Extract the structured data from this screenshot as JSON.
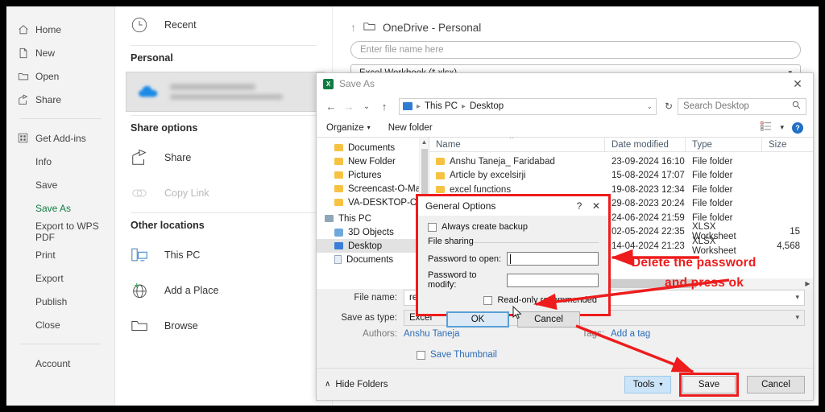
{
  "backstage": {
    "sidebar": [
      {
        "label": "Home",
        "icon": "home-icon",
        "type": "icon"
      },
      {
        "label": "New",
        "icon": "new-document-icon",
        "type": "icon"
      },
      {
        "label": "Open",
        "icon": "open-folder-icon",
        "type": "icon"
      },
      {
        "label": "Share",
        "icon": "share-icon",
        "type": "icon"
      },
      {
        "label": "Get Add-ins",
        "icon": "addins-grid-icon",
        "type": "icon"
      },
      {
        "label": "Info",
        "type": "plain"
      },
      {
        "label": "Save",
        "type": "plain"
      },
      {
        "label": "Save As",
        "type": "plain",
        "active": true
      },
      {
        "label": "Export to WPS PDF",
        "type": "plain"
      },
      {
        "label": "Print",
        "type": "plain"
      },
      {
        "label": "Export",
        "type": "plain"
      },
      {
        "label": "Publish",
        "type": "plain"
      },
      {
        "label": "Close",
        "type": "plain"
      },
      {
        "label": "Account",
        "type": "plain"
      }
    ],
    "middle": {
      "recent": "Recent",
      "personal_heading": "Personal",
      "onedrive_blurred": true,
      "share_options_heading": "Share options",
      "share": "Share",
      "copy_link": "Copy Link",
      "other_locations_heading": "Other locations",
      "this_pc": "This PC",
      "add_a_place": "Add a Place",
      "browse": "Browse"
    },
    "right": {
      "location": "OneDrive - Personal",
      "filename_placeholder": "Enter file name here",
      "filetype": "Excel Workbook (*.xlsx)"
    }
  },
  "saveas": {
    "title": "Save As",
    "close_label": "✕",
    "nav": {
      "back": "←",
      "forward": "→",
      "recent_caret": "⌄",
      "up": "↑",
      "breadcrumb": [
        "This PC",
        "Desktop"
      ],
      "address_caret": "⌄",
      "refresh": "↻",
      "search_placeholder": "Search Desktop"
    },
    "toolbar": {
      "organize": "Organize",
      "organize_caret": "▾",
      "new_folder": "New folder",
      "view_caret": "▾",
      "help": "?"
    },
    "tree": [
      {
        "label": "Documents",
        "icon": "folder-icon",
        "kind": "fold"
      },
      {
        "label": "New Folder",
        "icon": "folder-icon",
        "kind": "fold"
      },
      {
        "label": "Pictures",
        "icon": "folder-icon",
        "kind": "fold"
      },
      {
        "label": "Screencast-O-Ma",
        "icon": "folder-icon",
        "kind": "fold"
      },
      {
        "label": "VA-DESKTOP-C6",
        "icon": "folder-icon",
        "kind": "fold"
      },
      {
        "label": "This PC",
        "icon": "this-pc-icon",
        "kind": "pc",
        "root": true
      },
      {
        "label": "3D Objects",
        "icon": "3d-objects-icon",
        "kind": "obj"
      },
      {
        "label": "Desktop",
        "icon": "desktop-icon",
        "kind": "desk",
        "selected": true
      },
      {
        "label": "Documents",
        "icon": "documents-icon",
        "kind": "doc"
      }
    ],
    "columns": [
      "Name",
      "Date modified",
      "Type",
      "Size"
    ],
    "rows": [
      {
        "name": "Anshu Taneja_ Faridabad",
        "date": "23-09-2024 16:10",
        "type": "File folder",
        "size": ""
      },
      {
        "name": "Article by excelsirji",
        "date": "15-08-2024 17:07",
        "type": "File folder",
        "size": ""
      },
      {
        "name": "excel functions",
        "date": "19-08-2023 12:34",
        "type": "File folder",
        "size": ""
      },
      {
        "name": "",
        "date": "29-08-2023 20:24",
        "type": "File folder",
        "size": ""
      },
      {
        "name": "",
        "date": "24-06-2024 21:59",
        "type": "File folder",
        "size": ""
      },
      {
        "name": "",
        "date": "02-05-2024 22:35",
        "type": "XLSX Worksheet",
        "size": "15"
      },
      {
        "name": "",
        "date": "14-04-2024 21:23",
        "type": "XLSX Worksheet",
        "size": "4,568"
      }
    ],
    "fields": {
      "filename_label": "File name:",
      "filename_value": "remov",
      "filetype_label": "Save as type:",
      "filetype_value": "Excel",
      "authors_label": "Authors:",
      "authors_value": "Anshu Taneja",
      "tags_label": "Tags:",
      "tags_value": "Add a tag",
      "save_thumbnail": "Save Thumbnail"
    },
    "footer": {
      "hide_folders": "Hide Folders",
      "hide_caret": "∧",
      "tools": "Tools",
      "tools_caret": "▾",
      "save": "Save",
      "cancel": "Cancel"
    }
  },
  "general_options": {
    "title": "General Options",
    "help": "?",
    "close": "✕",
    "always_create_backup": "Always create backup",
    "file_sharing": "File sharing",
    "password_to_open_label": "Password to open:",
    "password_to_open_value": "",
    "password_to_modify_label": "Password to modify:",
    "password_to_modify_value": "",
    "read_only_recommended": "Read-only recommended",
    "ok": "OK",
    "cancel": "Cancel"
  },
  "annotations": {
    "line1": "Delete the password",
    "line2": "and press ok",
    "color": "#ee1c1c"
  }
}
